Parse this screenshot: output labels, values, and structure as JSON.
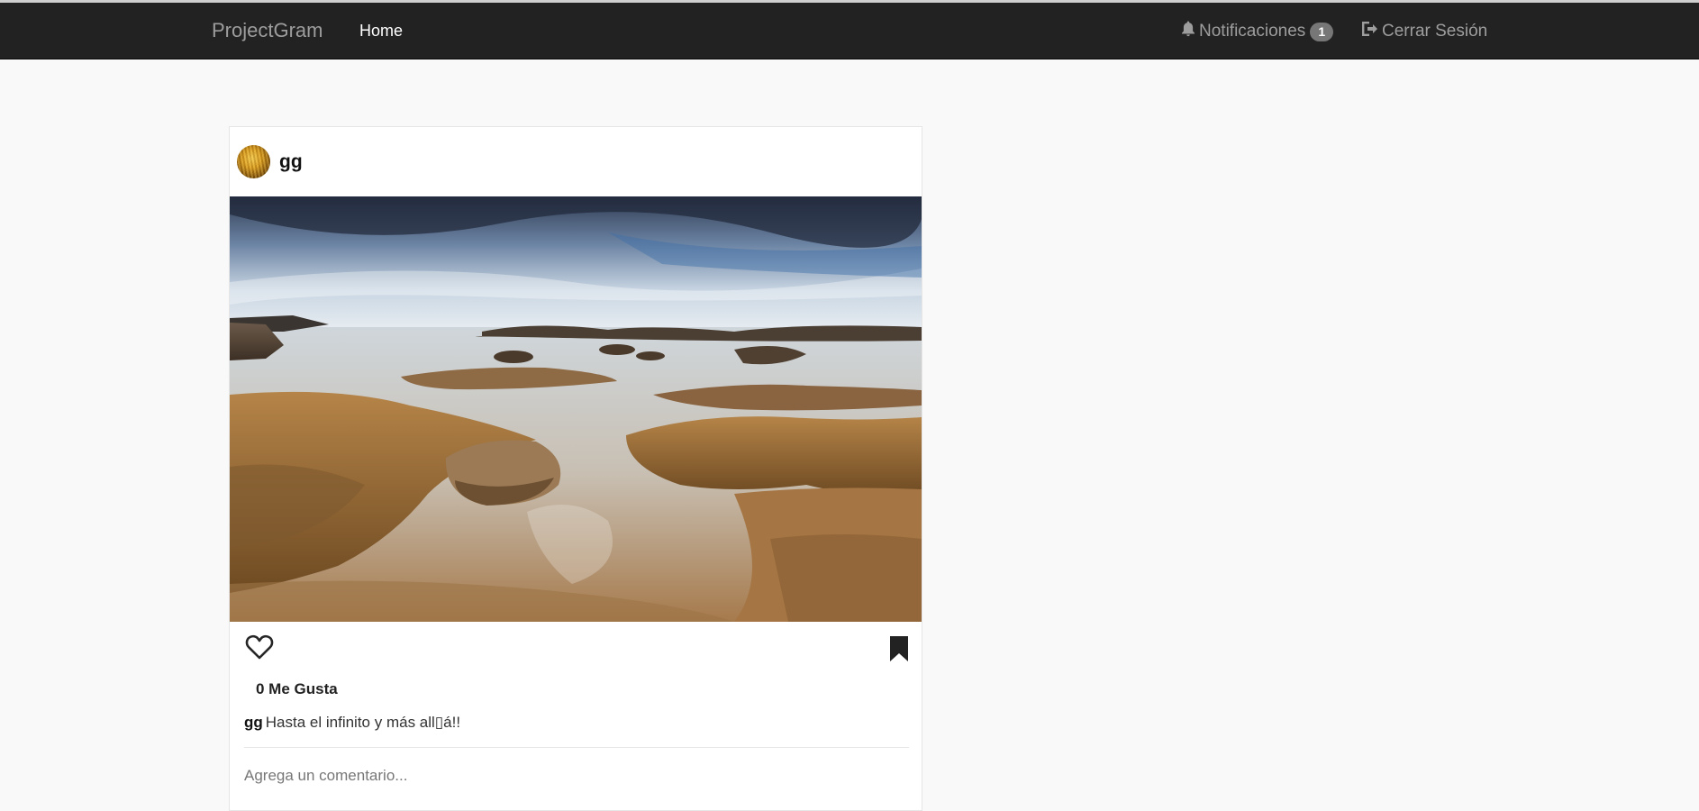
{
  "navbar": {
    "brand": "ProjectGram",
    "home_label": "Home",
    "notifications_label": "Notificaciones",
    "notifications_count": "1",
    "logout_label": "Cerrar Sesión",
    "icons": {
      "notifications": "bell-icon",
      "logout": "logout-icon"
    }
  },
  "post": {
    "username": "gg",
    "image_description_icon": "photo",
    "likes_text": "0 Me Gusta",
    "caption_user": "gg",
    "caption_text": "Hasta el infinito y más all▯á!!",
    "comment_placeholder": "Agrega un comentario...",
    "icons": {
      "like": "heart-icon",
      "save": "bookmark-icon"
    }
  },
  "colors": {
    "navbar_bg": "#222222",
    "navbar_text": "#9d9d9d",
    "page_bg": "#f9f9f9",
    "badge_bg": "#777777"
  }
}
